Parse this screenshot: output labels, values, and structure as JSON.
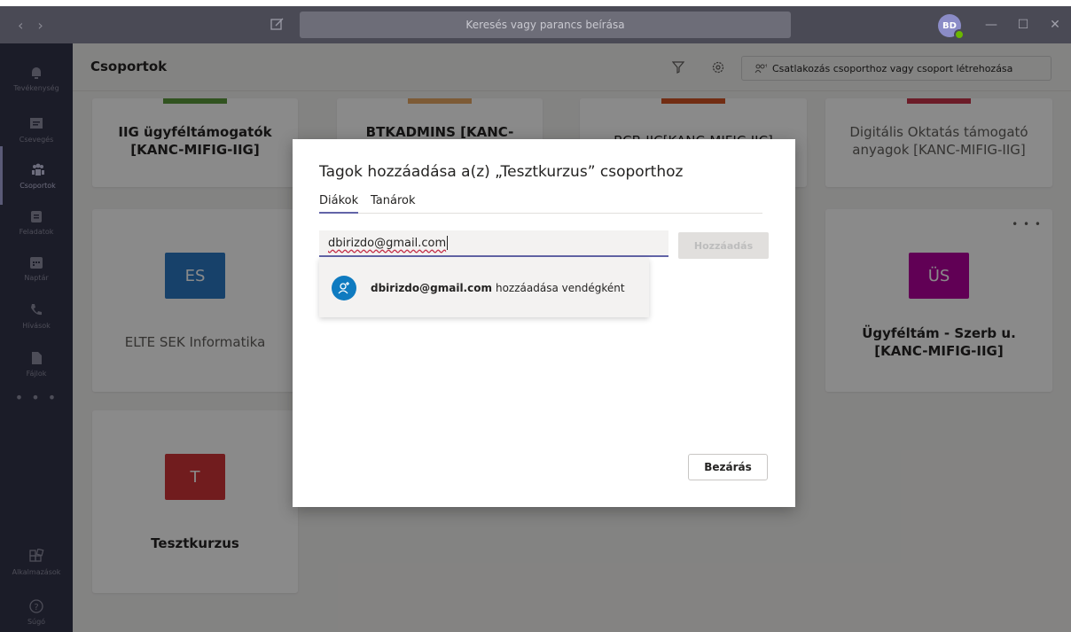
{
  "window": {
    "search_placeholder": "Keresés vagy parancs beírása",
    "avatar_initials": "BD",
    "nav_back": "‹",
    "nav_forward": "›",
    "minimize": "—",
    "maximize": "☐",
    "close": "✕"
  },
  "rail": {
    "items": [
      {
        "label": "Tevékenység",
        "icon": "bell-icon"
      },
      {
        "label": "Csevegés",
        "icon": "chat-icon"
      },
      {
        "label": "Csoportok",
        "icon": "teams-icon",
        "active": true
      },
      {
        "label": "Feladatok",
        "icon": "assignments-icon"
      },
      {
        "label": "Naptár",
        "icon": "calendar-icon"
      },
      {
        "label": "Hívások",
        "icon": "phone-icon"
      },
      {
        "label": "Fájlok",
        "icon": "files-icon"
      }
    ],
    "more": "• • •",
    "apps_label": "Alkalmazások",
    "help_label": "Súgó"
  },
  "header": {
    "title": "Csoportok",
    "join_label": "Csatlakozás csoporthoz vagy csoport létrehozása"
  },
  "teams": [
    {
      "name": "IIG ügyféltámogatók [KANC-MIFIG-IIG]",
      "color": "#5c9a3c"
    },
    {
      "name": "BTKADMINS [KANC-",
      "color": "#e8a865"
    },
    {
      "name": "BCB-IIC[KANC-MIFIC-IIC]",
      "color": "#d35423"
    },
    {
      "name": "Digitális Oktatás támogató anyagok [KANC-MIFIG-IIG]",
      "color": "#c8344a"
    },
    {
      "name": "ELTE SEK Informatika",
      "initials": "ES",
      "color": "#2b78c5"
    },
    {
      "name": "Ügyféltám - Szerb u. [KANC-MIFIG-IIG]",
      "initials": "ÜS",
      "color": "#b4009e"
    },
    {
      "name": "Tesztkurzus",
      "initials": "T",
      "color": "#d13438"
    }
  ],
  "team_more": "• • •",
  "dialog": {
    "title": "Tagok hozzáadása a(z) „Tesztkurzus” csoporthoz",
    "tabs": [
      "Diákok",
      "Tanárok"
    ],
    "email_value": "dbirizdo@gmail.com",
    "add_label": "Hozzáadás",
    "suggestion_email": "dbirizdo@gmail.com",
    "suggestion_suffix": "hozzáadása vendégként",
    "close_label": "Bezárás"
  }
}
